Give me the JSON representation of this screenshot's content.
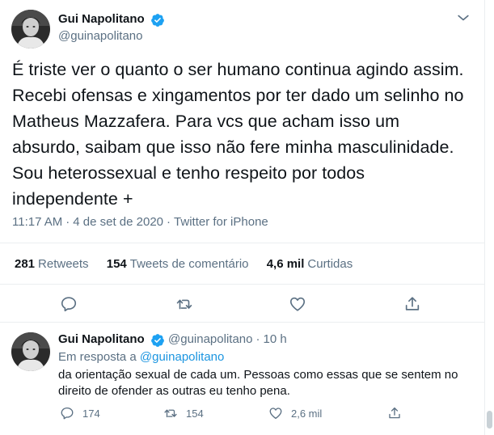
{
  "main_tweet": {
    "author_name": "Gui Napolitano",
    "author_handle": "@guinapolitano",
    "text": "É triste ver o quanto o ser humano continua agindo assim. Recebi ofensas e xingamentos por ter dado um selinho no Matheus Mazzafera. Para vcs que acham isso um absurdo, saibam que isso não fere minha masculinidade. Sou heterossexual e tenho respeito por todos independente +",
    "time": "11:17 AM",
    "date": "4 de set de 2020",
    "source": "Twitter for iPhone",
    "separator": "·",
    "stats": {
      "retweets_count": "281",
      "retweets_label": "Retweets",
      "comments_count": "154",
      "comments_label": "Tweets de comentário",
      "likes_count": "4,6 mil",
      "likes_label": "Curtidas"
    },
    "actions": [
      "reply-icon",
      "retweet-icon",
      "like-icon",
      "share-icon"
    ]
  },
  "reply_tweet": {
    "author_name": "Gui Napolitano",
    "author_handle": "@guinapolitano",
    "separator": "·",
    "age": "10 h",
    "in_reply_to_prefix": "Em resposta a",
    "in_reply_to_handle": "@guinapolitano",
    "text": "da orientação sexual de cada um. Pessoas como essas que se sentem no direito de ofender as outras eu tenho pena.",
    "counts": {
      "replies": "174",
      "retweets": "154",
      "likes": "2,6 mil"
    }
  },
  "colors": {
    "accent": "#1da1f2",
    "secondary_text": "#5b7083",
    "border": "#ebeef0",
    "mention": "#1b95e0"
  }
}
